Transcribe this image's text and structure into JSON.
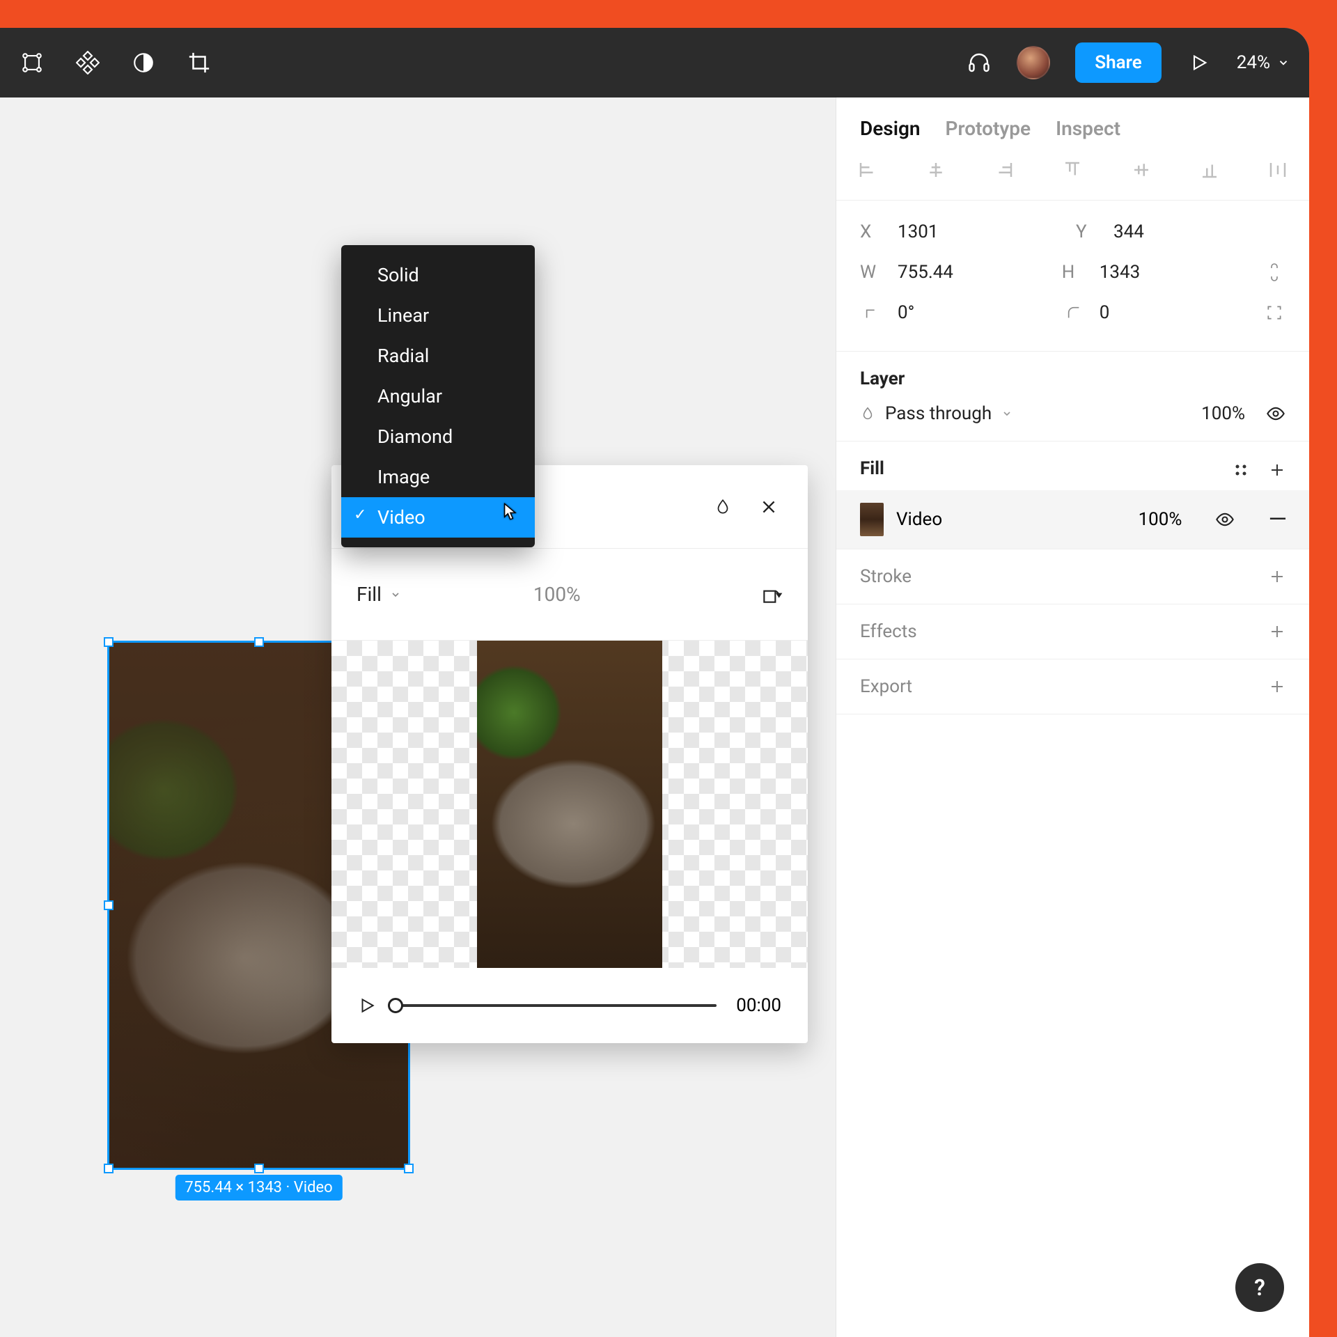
{
  "toolbar": {
    "share_label": "Share",
    "zoom": "24%"
  },
  "tabs": {
    "design": "Design",
    "prototype": "Prototype",
    "inspect": "Inspect"
  },
  "props": {
    "x_label": "X",
    "x": "1301",
    "y_label": "Y",
    "y": "344",
    "w_label": "W",
    "w": "755.44",
    "h_label": "H",
    "h": "1343",
    "rotation": "0°",
    "corner": "0"
  },
  "layer": {
    "title": "Layer",
    "mode": "Pass through",
    "opacity": "100%"
  },
  "fill": {
    "title": "Fill",
    "item_label": "Video",
    "item_opacity": "100%"
  },
  "stroke": {
    "title": "Stroke"
  },
  "effects": {
    "title": "Effects"
  },
  "export": {
    "title": "Export"
  },
  "selection_tag": "755.44 × 1343 · Video",
  "popover": {
    "mode": "Fill",
    "opacity": "100%",
    "time": "00:00"
  },
  "dropdown": {
    "items": [
      "Solid",
      "Linear",
      "Radial",
      "Angular",
      "Diamond",
      "Image",
      "Video"
    ],
    "selected_index": 6
  },
  "help": "?"
}
